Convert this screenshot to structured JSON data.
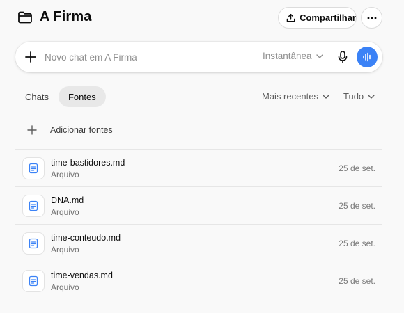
{
  "header": {
    "title": "A Firma",
    "share_label": "Compartilhar",
    "icons": {
      "folder": "folder-icon",
      "share": "share-icon",
      "more": "more-icon"
    }
  },
  "composer": {
    "placeholder": "Novo chat em A Firma",
    "model_label": "Instantânea",
    "icons": {
      "add": "plus-icon",
      "mic": "mic-icon",
      "voice": "voice-waveform-icon"
    },
    "accent": "#3b82f6"
  },
  "tabs": [
    {
      "label": "Chats",
      "active": false
    },
    {
      "label": "Fontes",
      "active": true
    }
  ],
  "filters": {
    "sort_label": "Mais recentes",
    "scope_label": "Tudo"
  },
  "add_sources_label": "Adicionar fontes",
  "files": [
    {
      "name": "time-bastidores.md",
      "type": "Arquivo",
      "date": "25 de set."
    },
    {
      "name": "DNA.md",
      "type": "Arquivo",
      "date": "25 de set."
    },
    {
      "name": "time-conteudo.md",
      "type": "Arquivo",
      "date": "25 de set."
    },
    {
      "name": "time-vendas.md",
      "type": "Arquivo",
      "date": "25 de set."
    }
  ]
}
